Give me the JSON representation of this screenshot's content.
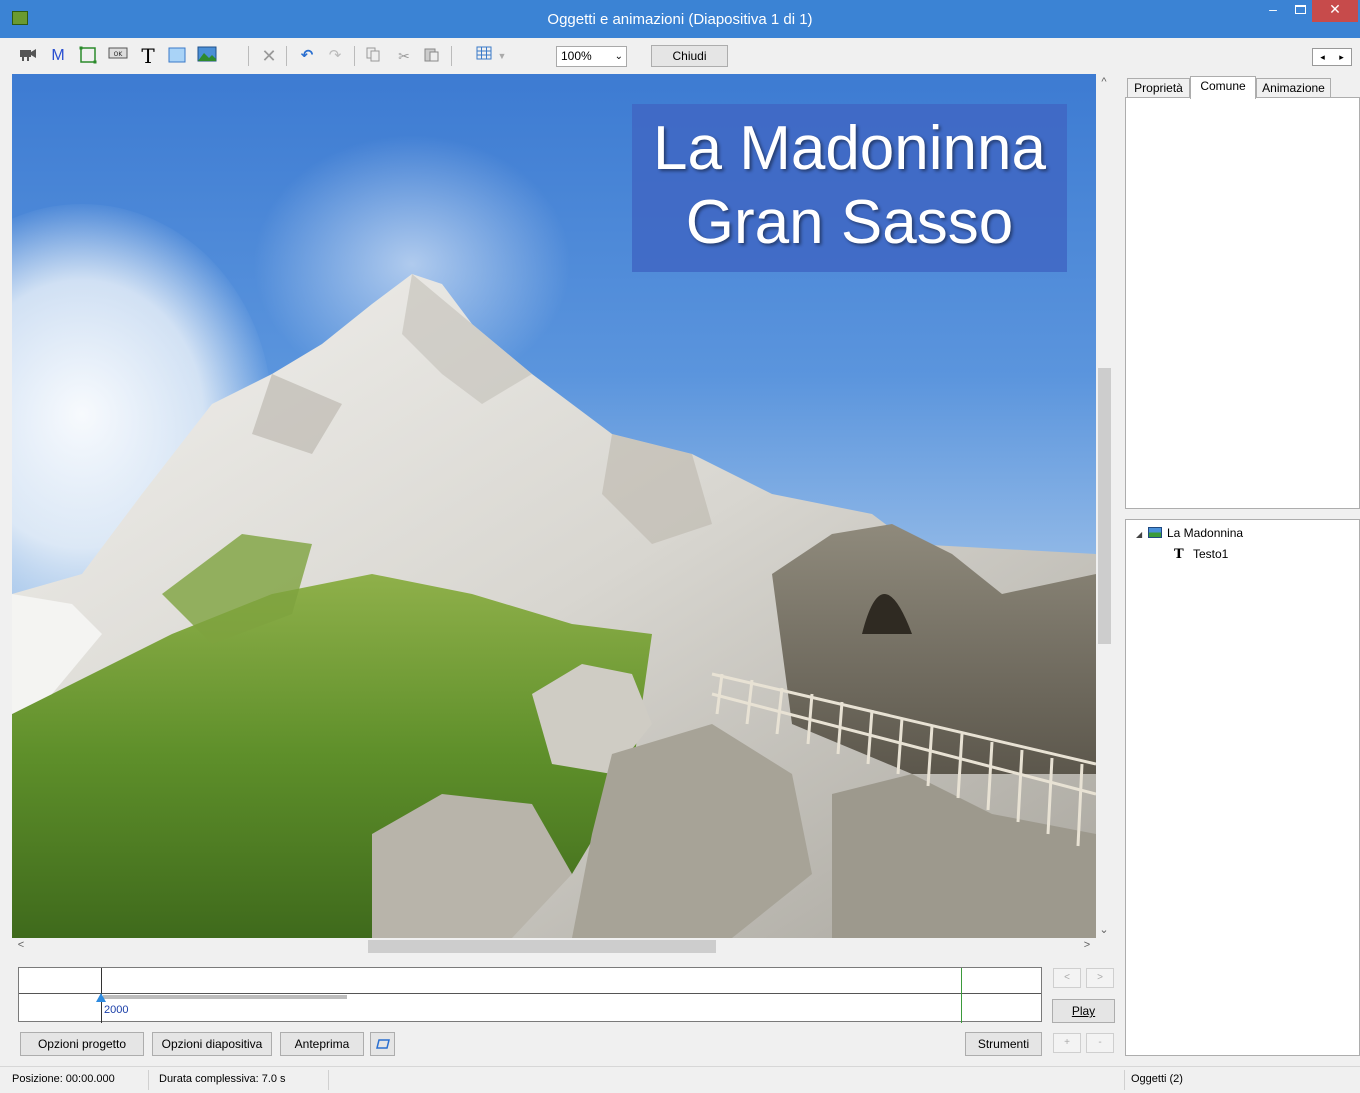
{
  "window": {
    "title": "Oggetti e animazioni  (Diapositiva 1 di 1)",
    "minimize": "–",
    "close": "✕"
  },
  "toolbar": {
    "icons": [
      "camera-icon",
      "mask-icon",
      "frame-icon",
      "button-icon",
      "text-icon",
      "rectangle-icon",
      "image-icon",
      "delete-icon",
      "undo-icon",
      "redo-icon",
      "copy-icon",
      "cut-icon",
      "paste-icon",
      "grid-icon"
    ],
    "text_tool_label": "T",
    "mask_tool_label": "M",
    "zoom_value": "100%",
    "close_label": "Chiudi"
  },
  "slide": {
    "title_line_1": "La Madoninna",
    "title_line_2": "Gran Sasso"
  },
  "timeline": {
    "marker_label": "2000"
  },
  "buttons": {
    "play": "Play",
    "project_options": "Opzioni progetto",
    "slide_options": "Opzioni diapositiva",
    "preview": "Anteprima",
    "tools": "Strumenti",
    "prev": "<",
    "next": ">",
    "add": "+",
    "remove": "-"
  },
  "tabs": [
    "Proprietà",
    "Comune",
    "Animazione"
  ],
  "active_tab": "Comune",
  "objects_tree": [
    {
      "label": "La Madonnina",
      "icon": "image-icon"
    },
    {
      "label": "Testo1",
      "icon": "text-icon"
    }
  ],
  "status": {
    "position": "Posizione:  00:00.000",
    "duration": "Durata complessiva:  7.0 s",
    "objects": "Oggetti (2)"
  },
  "colors": {
    "titlebar": "#3b83d4",
    "title_box": "#4068c4",
    "close_button": "#c74b4b"
  }
}
